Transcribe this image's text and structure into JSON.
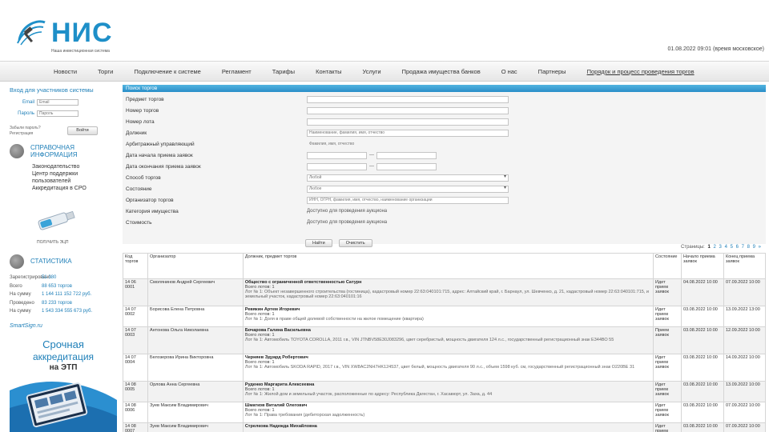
{
  "brand": {
    "logo_text": "НИС",
    "logo_sub": "Наша инвестиционная система",
    "header_right": "01.08.2022 09:01 (время московское)",
    "accent": "#1e8fc8"
  },
  "nav": {
    "items": [
      "Новости",
      "Торги",
      "Подключение к системе",
      "Регламент",
      "Тарифы",
      "Контакты",
      "Услуги",
      "Продажа имущества банков",
      "О нас",
      "Партнеры",
      "Порядок и процесс проведения торгов"
    ]
  },
  "login": {
    "title": "Вход для участников системы",
    "email_label": "Email",
    "email_placeholder": "Email",
    "password_label": "Пароль",
    "password_placeholder": "Пароль",
    "link1": "Забыли пароль?",
    "link2": "Регистрация",
    "button": "Войти"
  },
  "info": {
    "title_line1": "СПРАВОЧНАЯ",
    "title_line2": "ИНФОРМАЦИЯ",
    "items": [
      "Законодательство",
      "Центр поддержки",
      "пользователей",
      "Аккредитация в СРО"
    ]
  },
  "flash": {
    "label": "ПОЛУЧИТЬ ЭЦП"
  },
  "stats": {
    "title": "СТАТИСТИКА",
    "rows": [
      {
        "k": "Зарегистрировано",
        "v": "51 380"
      },
      {
        "k": "Всего",
        "v": "88 653 торгов"
      },
      {
        "k": "На сумму",
        "v": "1 144 111 152 722 руб."
      },
      {
        "k": "Проведено",
        "v": "83 233 торгов"
      },
      {
        "k": "На сумму",
        "v": "1 543 334 555 673 руб."
      }
    ]
  },
  "banner": {
    "logo": "SmartSign.ru",
    "line1": "Срочная",
    "line2": "аккредитация",
    "line3": "на ЭТП"
  },
  "form": {
    "title": "Поиск торгов",
    "fields": [
      {
        "label": "Предмет торгов",
        "value": ""
      },
      {
        "label": "Номер торгов",
        "value": ""
      },
      {
        "label": "Номер лота",
        "value": ""
      },
      {
        "label": "Должник",
        "value": "Наименование, фамилия, имя, отчество"
      },
      {
        "label": "Арбитражный управляющий",
        "value": "Фамилия, имя, отчество"
      },
      {
        "label": "Дата начала приема заявок",
        "from": "",
        "to": ""
      },
      {
        "label": "Дата окончания приема заявок",
        "from": "",
        "to": ""
      },
      {
        "label": "Способ торгов",
        "value": "Любой"
      },
      {
        "label": "Состояние",
        "value": "Любое"
      },
      {
        "label": "Организатор торгов",
        "value": "ИНН, ОГРН, фамилия, имя, отчество, наименование организации"
      },
      {
        "label": "Категория имущества",
        "value": "Доступно для проведения аукциона"
      },
      {
        "label": "Стоимость",
        "value": "Доступно для проведения аукциона"
      }
    ],
    "btn_search": "Найти",
    "btn_reset": "Очистить"
  },
  "pager": {
    "label": "Страницы:",
    "current": "1",
    "pages": [
      "2",
      "3",
      "4",
      "5",
      "6",
      "7",
      "8",
      "9",
      "»"
    ]
  },
  "table": {
    "headers": [
      "Код торгов",
      "Организатор",
      "Должник, предмет торгов",
      "Состояние",
      "Начало приема заявок",
      "Конец приема заявок"
    ],
    "rows": [
      {
        "code": "14 06 0001",
        "org": "Смолянинов Андрей Сергеевич",
        "title": "Общество с ограниченной ответственностью Сатурн",
        "lot": "Всего лотов: 1",
        "desc": "Лот № 1: Объект незавершенного строительства (гостиница), кадастровый номер 22:63:040101:715, адрес: Алтайский край, г. Барнаул, ул. Шевченко, д. 21, кадастровый номер 22:63:040101:715, и земельный участок, кадастровый номер 22:63:040101:16",
        "state": "Идет прием заявок",
        "start": "04.08.2022 10:00",
        "end": "07.09.2022 10:00"
      },
      {
        "code": "14 07 0002",
        "org": "Борисова Елена Петровна",
        "title": "Ревякин Артем Игоревич",
        "lot": "Всего лотов: 1",
        "desc": "Лот № 1: Доля в праве общей долевой собственности на жилое помещение (квартира)",
        "state": "Идет прием заявок",
        "start": "03.08.2022 10:00",
        "end": "13.09.2022 13:00"
      },
      {
        "code": "14 07 0003",
        "org": "Антонова Ольга Николаевна",
        "title": "Бочарова Галина Васильевна",
        "lot": "Всего лотов: 1",
        "desc": "Лот № 1: Автомобиль TOYOTA COROLLA, 2011 г.в., VIN JTNBV58E30J083296, цвет серебристый, мощность двигателя 124 л.с., государственный регистрационный знак Е344ВО 55",
        "state": "Прием заявок",
        "start": "03.08.2022 10:00",
        "end": "12.09.2022 10:00"
      },
      {
        "code": "14 07 0004",
        "org": "Белозерова Ирина Викторовна",
        "title": "Черняев Эдуард Робертович",
        "lot": "Всего лотов: 1",
        "desc": "Лот № 1: Автомобиль SKODA RAPID, 2017 г.в., VIN XW8AC2NH7HK124537, цвет белый, мощность двигателя 90 л.с., объем 1598 куб. см, государственный регистрационный знак О220ВЕ 31",
        "state": "Идет прием заявок",
        "start": "03.08.2022 10:00",
        "end": "14.09.2022 10:00"
      },
      {
        "code": "14 08 0005",
        "org": "Орлова Анна Сергеевна",
        "title": "Руденко Маргарита Алексеевна",
        "lot": "Всего лотов: 1",
        "desc": "Лот № 1: Жилой дом и земельный участок, расположенные по адресу: Республика Дагестан, г. Хасавюрт, ул. Заха, д. 44",
        "state": "Идет прием заявок",
        "start": "03.08.2022 10:00",
        "end": "13.09.2022 10:00"
      },
      {
        "code": "14 08 0006",
        "org": "Зуев Максим Владимирович",
        "title": "Шматков Виталий Олегович",
        "lot": "Всего лотов: 1",
        "desc": "Лот № 1: Права требования (дебиторская задолженность)",
        "state": "Идет прием заявок",
        "start": "03.08.2022 10:00",
        "end": "07.09.2022 10:00"
      },
      {
        "code": "14 08 0007",
        "org": "Зуев Максим Владимирович",
        "title": "Стрелкова Надежда Михайловна",
        "lot": "",
        "desc": "",
        "state": "Идет прием заявок",
        "start": "03.08.2022 10:00",
        "end": "07.09.2022 10:00"
      }
    ]
  }
}
